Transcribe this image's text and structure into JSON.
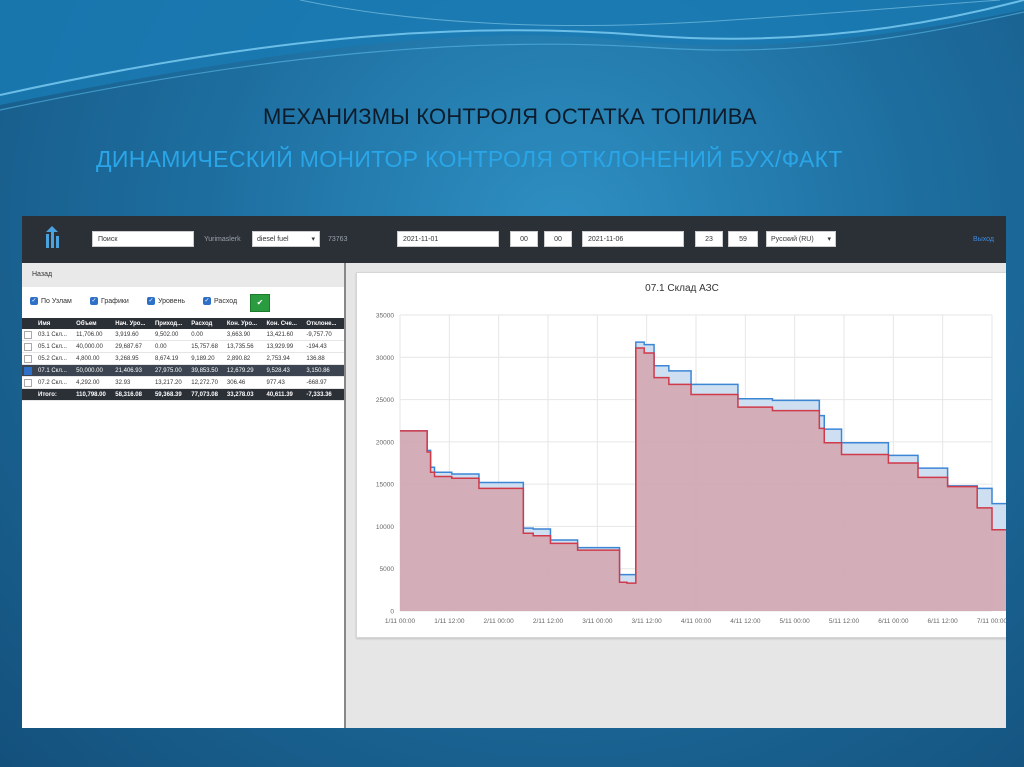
{
  "slide": {
    "title": "МЕХАНИЗМЫ КОНТРОЛЯ ОСТАТКА ТОПЛИВА",
    "subtitle": "ДИНАМИЧЕСКИЙ МОНИТОР КОНТРОЛЯ ОТКЛОНЕНИЙ БУХ/ФАКТ"
  },
  "topbar": {
    "search_placeholder": "Поиск",
    "user": "Yurimaslerk",
    "fuel_select": "diesel fuel",
    "code": "73763",
    "date_from": "2021-11-01",
    "hour_from": "00",
    "min_from": "00",
    "date_to": "2021-11-06",
    "hour_to": "23",
    "min_to": "59",
    "language": "Русский (RU)",
    "logout": "Выход"
  },
  "left": {
    "back": "Назад",
    "checkboxes": [
      "По Узлам",
      "Графики",
      "Уровень",
      "Расход"
    ],
    "apply_icon": "check-icon"
  },
  "table": {
    "headers": [
      "Имя",
      "Объем",
      "Нач. Уро...",
      "Приход...",
      "Расход",
      "Кон. Уро...",
      "Кон. Сче...",
      "Отклоне..."
    ],
    "rows": [
      {
        "checked": false,
        "name": "03.1 Скл...",
        "vol": "11,706.00",
        "start": "3,919.60",
        "income": "9,502.00",
        "expense": "0.00",
        "end": "3,663.90",
        "counter": "13,421.60",
        "dev": "-9,757.70"
      },
      {
        "checked": false,
        "name": "05.1 Скл...",
        "vol": "40,000.00",
        "start": "29,687.67",
        "income": "0.00",
        "expense": "15,757.68",
        "end": "13,735.56",
        "counter": "13,929.99",
        "dev": "-194.43"
      },
      {
        "checked": false,
        "name": "05.2 Скл...",
        "vol": "4,800.00",
        "start": "3,268.95",
        "income": "8,674.19",
        "expense": "9,189.20",
        "end": "2,890.82",
        "counter": "2,753.94",
        "dev": "136.88"
      },
      {
        "checked": true,
        "name": "07.1 Скл...",
        "vol": "50,000.00",
        "start": "21,406.93",
        "income": "27,975.00",
        "expense": "39,853.50",
        "end": "12,679.29",
        "counter": "9,528.43",
        "dev": "3,150.86"
      },
      {
        "checked": false,
        "name": "07.2 Скл...",
        "vol": "4,292.00",
        "start": "32.93",
        "income": "13,217.20",
        "expense": "12,272.70",
        "end": "306.46",
        "counter": "977.43",
        "dev": "-668.97"
      }
    ],
    "total": {
      "label": "Итого:",
      "vol": "110,798.00",
      "start": "58,316.08",
      "income": "59,368.39",
      "expense": "77,073.08",
      "end": "33,278.03",
      "counter": "40,611.39",
      "dev": "-7,333.36"
    }
  },
  "chart_data": {
    "type": "area",
    "title": "07.1 Склад АЗС",
    "xlabel": "",
    "ylabel": "",
    "ylim": [
      0,
      35000
    ],
    "yticks": [
      0,
      5000,
      10000,
      15000,
      20000,
      25000,
      30000,
      35000
    ],
    "xlim": [
      0,
      6
    ],
    "xtick_labels": [
      "1/11 00:00",
      "1/11 12:00",
      "2/11 00:00",
      "2/11 12:00",
      "3/11 00:00",
      "3/11 12:00",
      "4/11 00:00",
      "4/11 12:00",
      "5/11 00:00",
      "5/11 12:00",
      "6/11 00:00",
      "6/11 12:00",
      "7/11 00:00"
    ],
    "grid": true,
    "series": [
      {
        "color": "#3d86d6",
        "fill": "#c8dcef",
        "points": [
          [
            0.0,
            21300
          ],
          [
            0.3,
            21300
          ],
          [
            0.55,
            19000
          ],
          [
            0.62,
            17000
          ],
          [
            0.7,
            16400
          ],
          [
            1.05,
            16200
          ],
          [
            1.6,
            15200
          ],
          [
            2.5,
            9800
          ],
          [
            2.7,
            9700
          ],
          [
            3.05,
            8400
          ],
          [
            3.6,
            7500
          ],
          [
            4.45,
            4300
          ],
          [
            4.6,
            4300
          ],
          [
            4.78,
            31800
          ],
          [
            4.95,
            31500
          ],
          [
            5.15,
            29000
          ],
          [
            5.45,
            28400
          ],
          [
            5.9,
            26800
          ],
          [
            6.85,
            25100
          ],
          [
            7.55,
            24900
          ],
          [
            8.5,
            23100
          ],
          [
            8.6,
            21500
          ],
          [
            8.95,
            19900
          ],
          [
            9.9,
            18400
          ],
          [
            10.5,
            16900
          ],
          [
            11.1,
            14800
          ],
          [
            11.7,
            14500
          ],
          [
            12.0,
            12700
          ],
          [
            12.3,
            12700
          ]
        ]
      },
      {
        "color": "#d03a4a",
        "fill": "#d3a4ad",
        "points": [
          [
            0.0,
            21300
          ],
          [
            0.3,
            21300
          ],
          [
            0.55,
            18800
          ],
          [
            0.62,
            16400
          ],
          [
            0.7,
            15900
          ],
          [
            1.05,
            15700
          ],
          [
            1.6,
            14500
          ],
          [
            2.5,
            9200
          ],
          [
            2.7,
            8900
          ],
          [
            3.05,
            8000
          ],
          [
            3.6,
            7200
          ],
          [
            4.45,
            3400
          ],
          [
            4.6,
            3300
          ],
          [
            4.78,
            31100
          ],
          [
            4.95,
            30500
          ],
          [
            5.15,
            27600
          ],
          [
            5.45,
            26800
          ],
          [
            5.9,
            25600
          ],
          [
            6.85,
            24100
          ],
          [
            7.55,
            23700
          ],
          [
            8.5,
            21600
          ],
          [
            8.6,
            19900
          ],
          [
            8.95,
            18500
          ],
          [
            9.9,
            17500
          ],
          [
            10.5,
            15800
          ],
          [
            11.1,
            14700
          ],
          [
            11.7,
            12200
          ],
          [
            12.0,
            9600
          ],
          [
            12.3,
            9600
          ]
        ]
      }
    ]
  }
}
